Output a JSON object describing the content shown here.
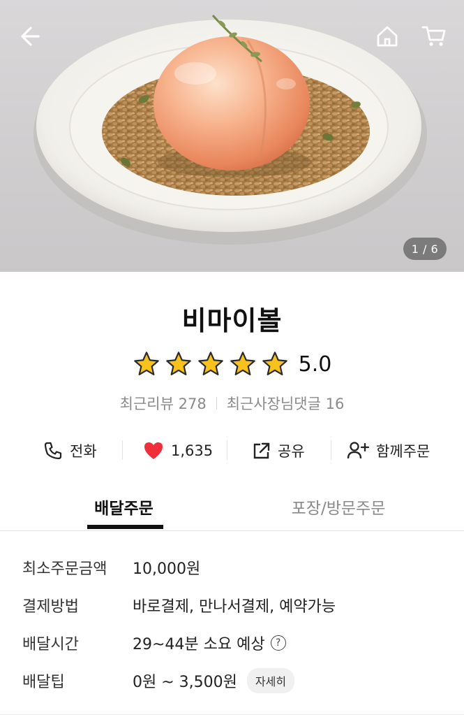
{
  "hero": {
    "image_counter": "1 / 6",
    "icons": [
      "back-arrow-icon",
      "home-icon",
      "cart-icon"
    ]
  },
  "store": {
    "name": "비마이볼",
    "rating": 5.0,
    "rating_text": "5.0",
    "star_count": 5,
    "recent_reviews_label": "최근리뷰 278",
    "owner_replies_label": "최근사장님댓글 16"
  },
  "actions": {
    "call_label": "전화",
    "like_count": "1,635",
    "share_label": "공유",
    "together_label": "함께주문"
  },
  "tabs": {
    "delivery": "배달주문",
    "pickup": "포장/방문주문"
  },
  "details": {
    "min_order_label": "최소주문금액",
    "min_order_value": "10,000원",
    "payment_label": "결제방법",
    "payment_value": "바로결제, 만나서결제, 예약가능",
    "time_label": "배달시간",
    "time_value": "29~44분 소요 예상",
    "tip_label": "배달팁",
    "tip_value": "0원 ~ 3,500원",
    "tip_detail_button": "자세히"
  },
  "colors": {
    "heart": "#ef2f3a",
    "star": "#f7c21b",
    "tab_active": "#111111",
    "tab_inactive": "#8a8a8a"
  }
}
